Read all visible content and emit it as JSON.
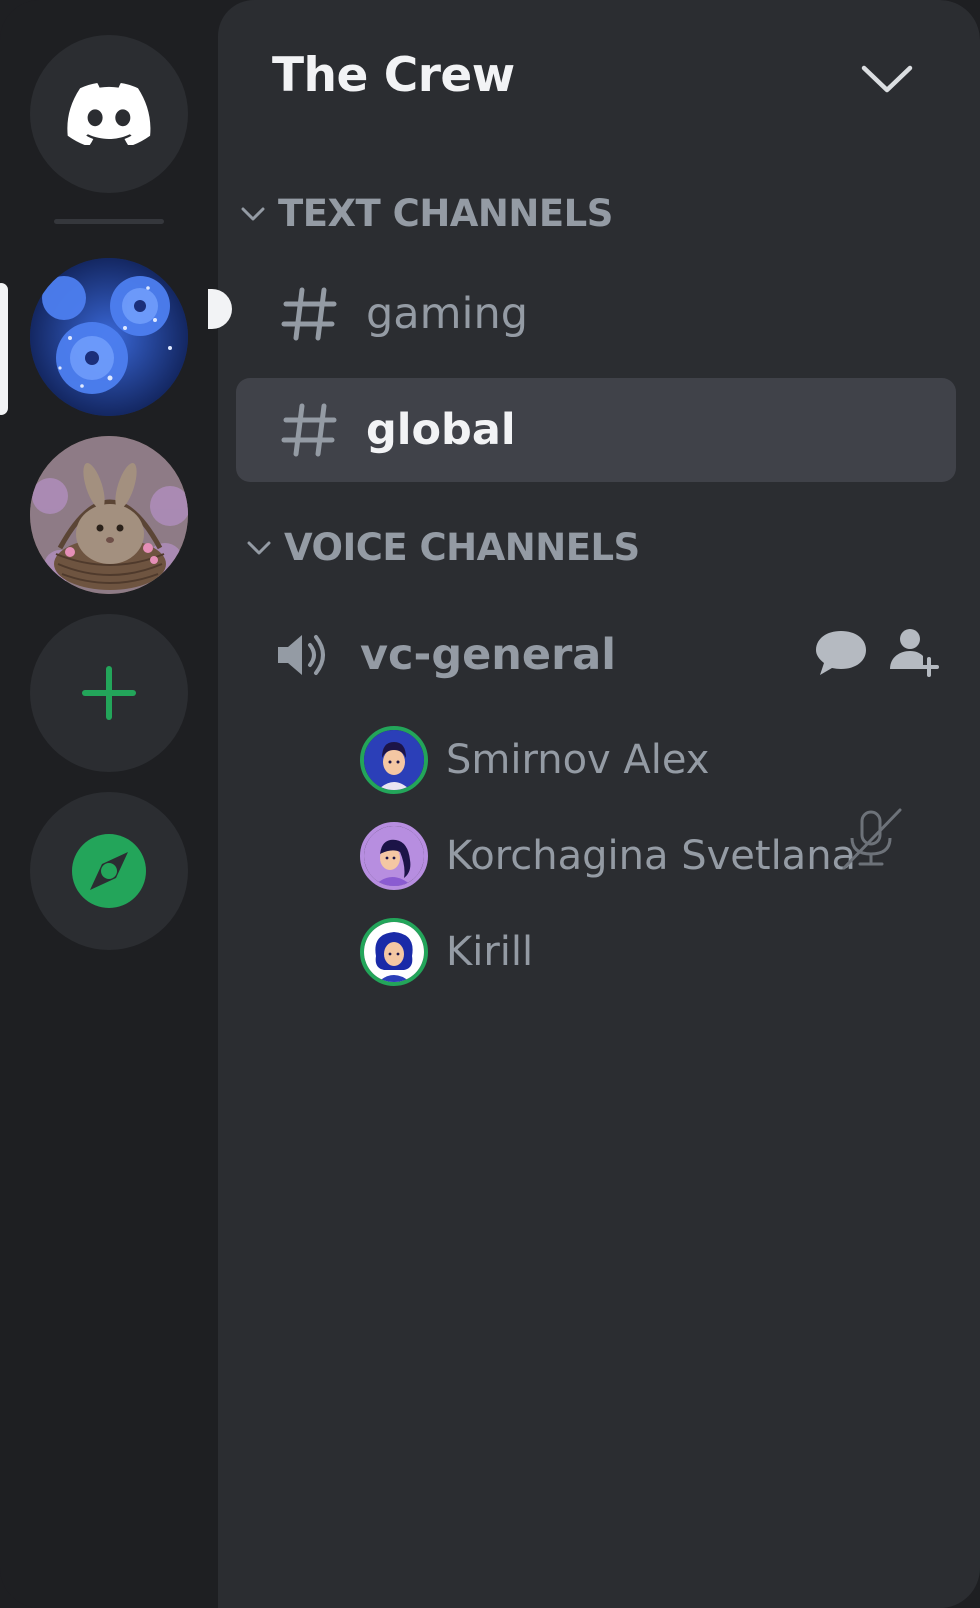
{
  "server": {
    "name": "The Crew"
  },
  "rail": {
    "servers": [
      {
        "name": "discord-home",
        "icon": "discord-logo-icon"
      },
      {
        "name": "blue-flowers-server",
        "icon": "blue-flowers-image"
      },
      {
        "name": "bunny-server",
        "icon": "bunny-basket-image"
      },
      {
        "name": "add-server",
        "icon": "plus-icon"
      },
      {
        "name": "explore",
        "icon": "compass-icon"
      }
    ],
    "accent": "#23a55a"
  },
  "categories": {
    "text": "TEXT CHANNELS",
    "voice": "VOICE CHANNELS"
  },
  "text_channels": [
    {
      "name": "gaming",
      "active": false,
      "unread": true
    },
    {
      "name": "global",
      "active": true,
      "unread": false
    }
  ],
  "voice_channel": {
    "name": "vc-general",
    "members": [
      {
        "name": "Smirnov Alex",
        "muted": false
      },
      {
        "name": "Korchagina Svetlana",
        "muted": true
      },
      {
        "name": "Kirill",
        "muted": false
      }
    ]
  },
  "colors": {
    "background": "#1e1f22",
    "panel": "#2b2d31",
    "active_channel": "#404249",
    "text_muted": "#949ba4",
    "text_bright": "#f2f3f5",
    "online_ring": "#23a55a"
  }
}
